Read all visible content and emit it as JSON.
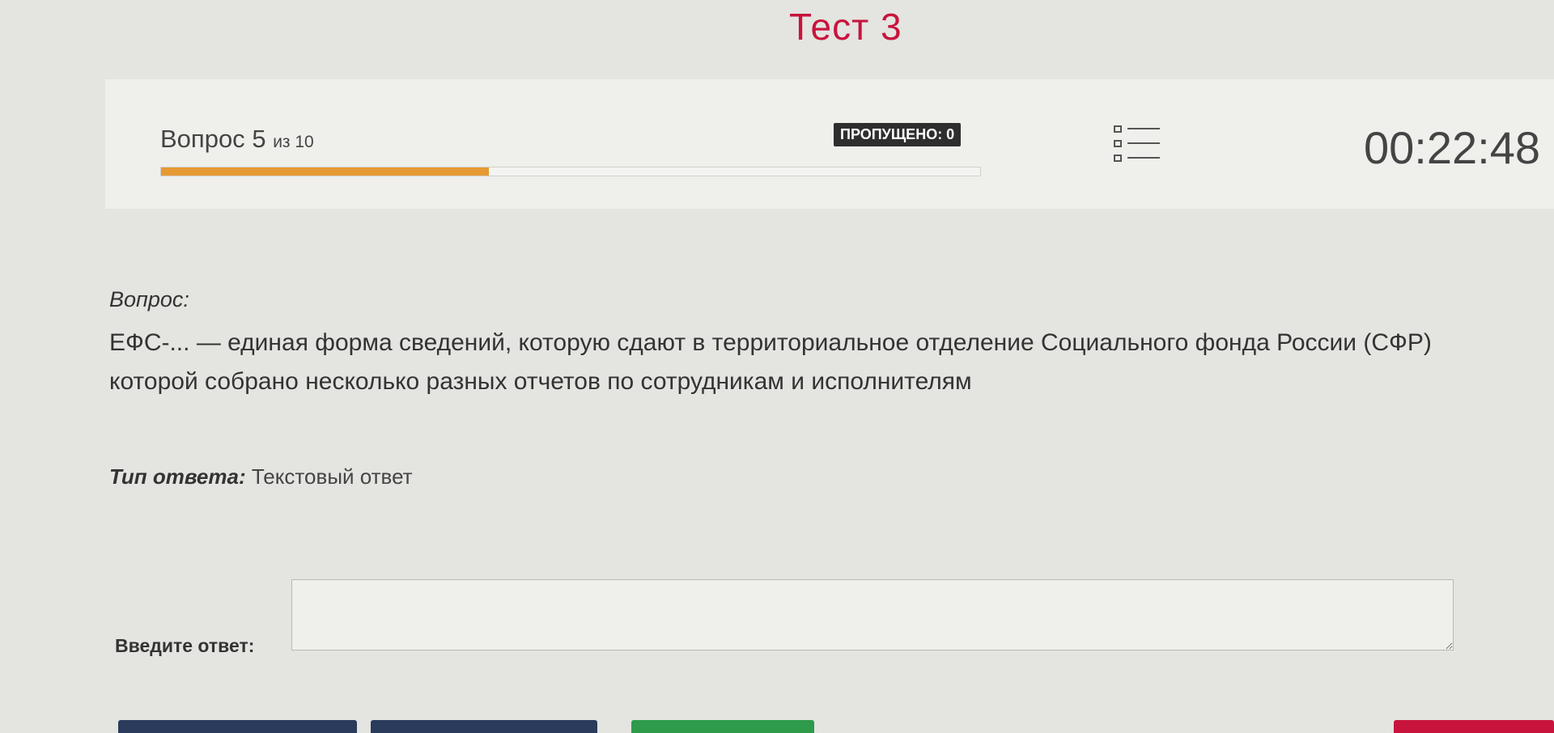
{
  "title": "Тест 3",
  "progress": {
    "question_word": "Вопрос",
    "current": "5",
    "of_text": "из 10",
    "fraction": 0.4
  },
  "skipped_label": "ПРОПУЩЕНО: 0",
  "timer": "00:22:48",
  "question": {
    "label": "Вопрос:",
    "line1": "ЕФС-... — единая форма сведений, которую сдают в территориальное отделение Социального фонда России (СФР)",
    "line2": "которой собрано несколько разных отчетов по сотрудникам и исполнителям"
  },
  "answer_type": {
    "label": "Тип ответа:",
    "value": "Текстовый ответ"
  },
  "answer": {
    "label": "Введите ответ:",
    "value": ""
  },
  "colors": {
    "title": "#c8143c",
    "progress_fill": "#e69a34",
    "button_dark_blue": "#2a3b5c",
    "button_green": "#2d9b4a",
    "button_red": "#c8143c"
  },
  "icons": {
    "question_list": "list-icon"
  }
}
